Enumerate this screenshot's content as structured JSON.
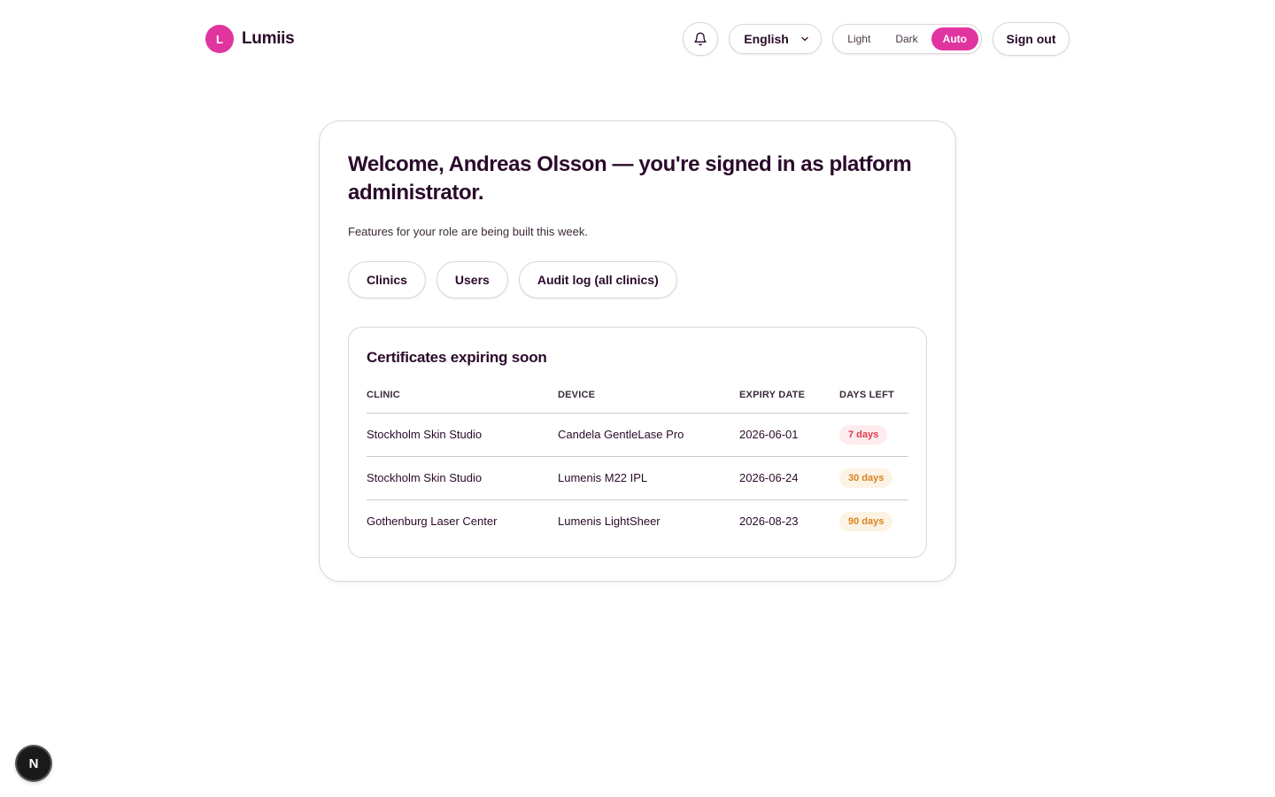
{
  "brand": {
    "initial": "L",
    "name": "Lumiis",
    "accent": "#e0359f"
  },
  "header": {
    "language": "English",
    "theme_options": [
      "Light",
      "Dark",
      "Auto"
    ],
    "theme_selected": "Auto",
    "sign_out_label": "Sign out"
  },
  "main": {
    "welcome": "Welcome, Andreas Olsson — you're signed in as platform administrator.",
    "subtitle": "Features for your role are being built this week.",
    "nav_buttons": [
      "Clinics",
      "Users",
      "Audit log (all clinics)"
    ]
  },
  "certificates": {
    "title": "Certificates expiring soon",
    "columns": [
      "CLINIC",
      "DEVICE",
      "EXPIRY DATE",
      "DAYS LEFT"
    ],
    "rows": [
      {
        "clinic": "Stockholm Skin Studio",
        "device": "Candela GentleLase Pro",
        "expiry": "2026-06-01",
        "days_left": "7 days",
        "status_color": "#e03a4a"
      },
      {
        "clinic": "Stockholm Skin Studio",
        "device": "Lumenis M22 IPL",
        "expiry": "2026-06-24",
        "days_left": "30 days",
        "status_color": "#d9821e"
      },
      {
        "clinic": "Gothenburg Laser Center",
        "device": "Lumenis LightSheer",
        "expiry": "2026-08-23",
        "days_left": "90 days",
        "status_color": "#d9821e"
      }
    ]
  },
  "dev_indicator": {
    "letter": "N"
  }
}
